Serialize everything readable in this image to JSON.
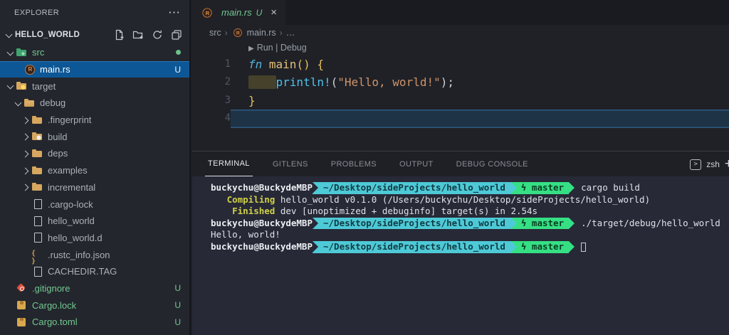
{
  "colors": {
    "untracked_green": "#73c991",
    "selection_blue": "#0d5796",
    "prompt_cyan": "#4ec9d6",
    "prompt_green": "#35e084",
    "folder_tan": "#d7a75f",
    "cargo_yellow": "#cfd147"
  },
  "sidebar": {
    "header": "EXPLORER",
    "project": {
      "name": "HELLO_WORLD"
    },
    "tree": [
      {
        "label": "src",
        "level": 0,
        "chevron": "open",
        "icon": "folder-src",
        "state": "green",
        "badge": "dot"
      },
      {
        "label": "main.rs",
        "level": 1,
        "chevron": null,
        "icon": "rust",
        "state": "selected",
        "badge": "U"
      },
      {
        "label": "target",
        "level": 0,
        "chevron": "open",
        "icon": "folder-target",
        "state": "normal",
        "badge": null
      },
      {
        "label": "debug",
        "level": 1,
        "chevron": "open",
        "icon": "folder-debug",
        "state": "normal",
        "badge": null
      },
      {
        "label": ".fingerprint",
        "level": 2,
        "chevron": "closed",
        "icon": "folder",
        "state": "normal",
        "badge": null
      },
      {
        "label": "build",
        "level": 2,
        "chevron": "closed",
        "icon": "folder-build",
        "state": "normal",
        "badge": null
      },
      {
        "label": "deps",
        "level": 2,
        "chevron": "closed",
        "icon": "folder",
        "state": "normal",
        "badge": null
      },
      {
        "label": "examples",
        "level": 2,
        "chevron": "closed",
        "icon": "folder",
        "state": "normal",
        "badge": null
      },
      {
        "label": "incremental",
        "level": 2,
        "chevron": "closed",
        "icon": "folder",
        "state": "normal",
        "badge": null
      },
      {
        "label": ".cargo-lock",
        "level": 2,
        "chevron": null,
        "icon": "file",
        "state": "normal",
        "badge": null
      },
      {
        "label": "hello_world",
        "level": 2,
        "chevron": null,
        "icon": "file",
        "state": "normal",
        "badge": null
      },
      {
        "label": "hello_world.d",
        "level": 2,
        "chevron": null,
        "icon": "file",
        "state": "normal",
        "badge": null
      },
      {
        "label": ".rustc_info.json",
        "level": 2,
        "chevron": null,
        "icon": "json",
        "state": "normal",
        "badge": null
      },
      {
        "label": "CACHEDIR.TAG",
        "level": 2,
        "chevron": null,
        "icon": "file",
        "state": "normal",
        "badge": null
      },
      {
        "label": ".gitignore",
        "level": 0,
        "chevron": null,
        "icon": "git",
        "state": "green",
        "badge": "U"
      },
      {
        "label": "Cargo.lock",
        "level": 0,
        "chevron": null,
        "icon": "crate",
        "state": "green",
        "badge": "U"
      },
      {
        "label": "Cargo.toml",
        "level": 0,
        "chevron": null,
        "icon": "crate",
        "state": "green",
        "badge": "U"
      }
    ]
  },
  "editor": {
    "tab": {
      "file": "main.rs",
      "modified": "U",
      "close": "×"
    },
    "breadcrumbs": {
      "crumb1": "src",
      "crumb2": "main.rs",
      "crumb3": "…",
      "sep": "›"
    },
    "codelens": {
      "icon": "▶",
      "run": "Run",
      "sep": "|",
      "debug": "Debug"
    },
    "code": {
      "lines": [
        {
          "num": "1",
          "tokens": [
            [
              "fn",
              "kw"
            ],
            [
              " ",
              "plain"
            ],
            [
              "main",
              "fname"
            ],
            [
              "()",
              "brace"
            ],
            [
              " ",
              "plain"
            ],
            [
              "{",
              "brace"
            ]
          ]
        },
        {
          "num": "2",
          "tokens": [
            [
              "    ",
              "hlbox"
            ],
            [
              "println!",
              "macro"
            ],
            [
              "(",
              "plain"
            ],
            [
              "\"Hello, world!\"",
              "str"
            ],
            [
              ")",
              "plain"
            ],
            [
              ";",
              "plain"
            ]
          ]
        },
        {
          "num": "3",
          "tokens": [
            [
              "}",
              "brace"
            ]
          ]
        },
        {
          "num": "4",
          "tokens": [],
          "current": true
        }
      ]
    }
  },
  "panel": {
    "tabs": [
      "TERMINAL",
      "GITLENS",
      "PROBLEMS",
      "OUTPUT",
      "DEBUG CONSOLE"
    ],
    "active_tab": "TERMINAL",
    "shell_label": "zsh",
    "new_terminal": "+"
  },
  "terminal": {
    "prompt": {
      "user": "buckychu@BuckydeMBP",
      "path": "~/Desktop/sideProjects/hello_world",
      "branch_icon": "ϟ",
      "branch": "master"
    },
    "lines": [
      {
        "prompt": true,
        "command": "cargo build"
      },
      {
        "spans": [
          [
            "   ",
            "plain"
          ],
          [
            "Compiling",
            "yellow"
          ],
          [
            " hello_world v0.1.0 (/Users/buckychu/Desktop/sideProjects/hello_world)",
            "plain"
          ]
        ]
      },
      {
        "spans": [
          [
            "    ",
            "plain"
          ],
          [
            "Finished",
            "yellow"
          ],
          [
            " dev [unoptimized + debuginfo] target(s) in 2.54s",
            "plain"
          ]
        ]
      },
      {
        "prompt": true,
        "command": "./target/debug/hello_world"
      },
      {
        "spans": [
          [
            "Hello, world!",
            "plain"
          ]
        ]
      },
      {
        "prompt": true,
        "command": "",
        "cursor": true
      }
    ]
  }
}
